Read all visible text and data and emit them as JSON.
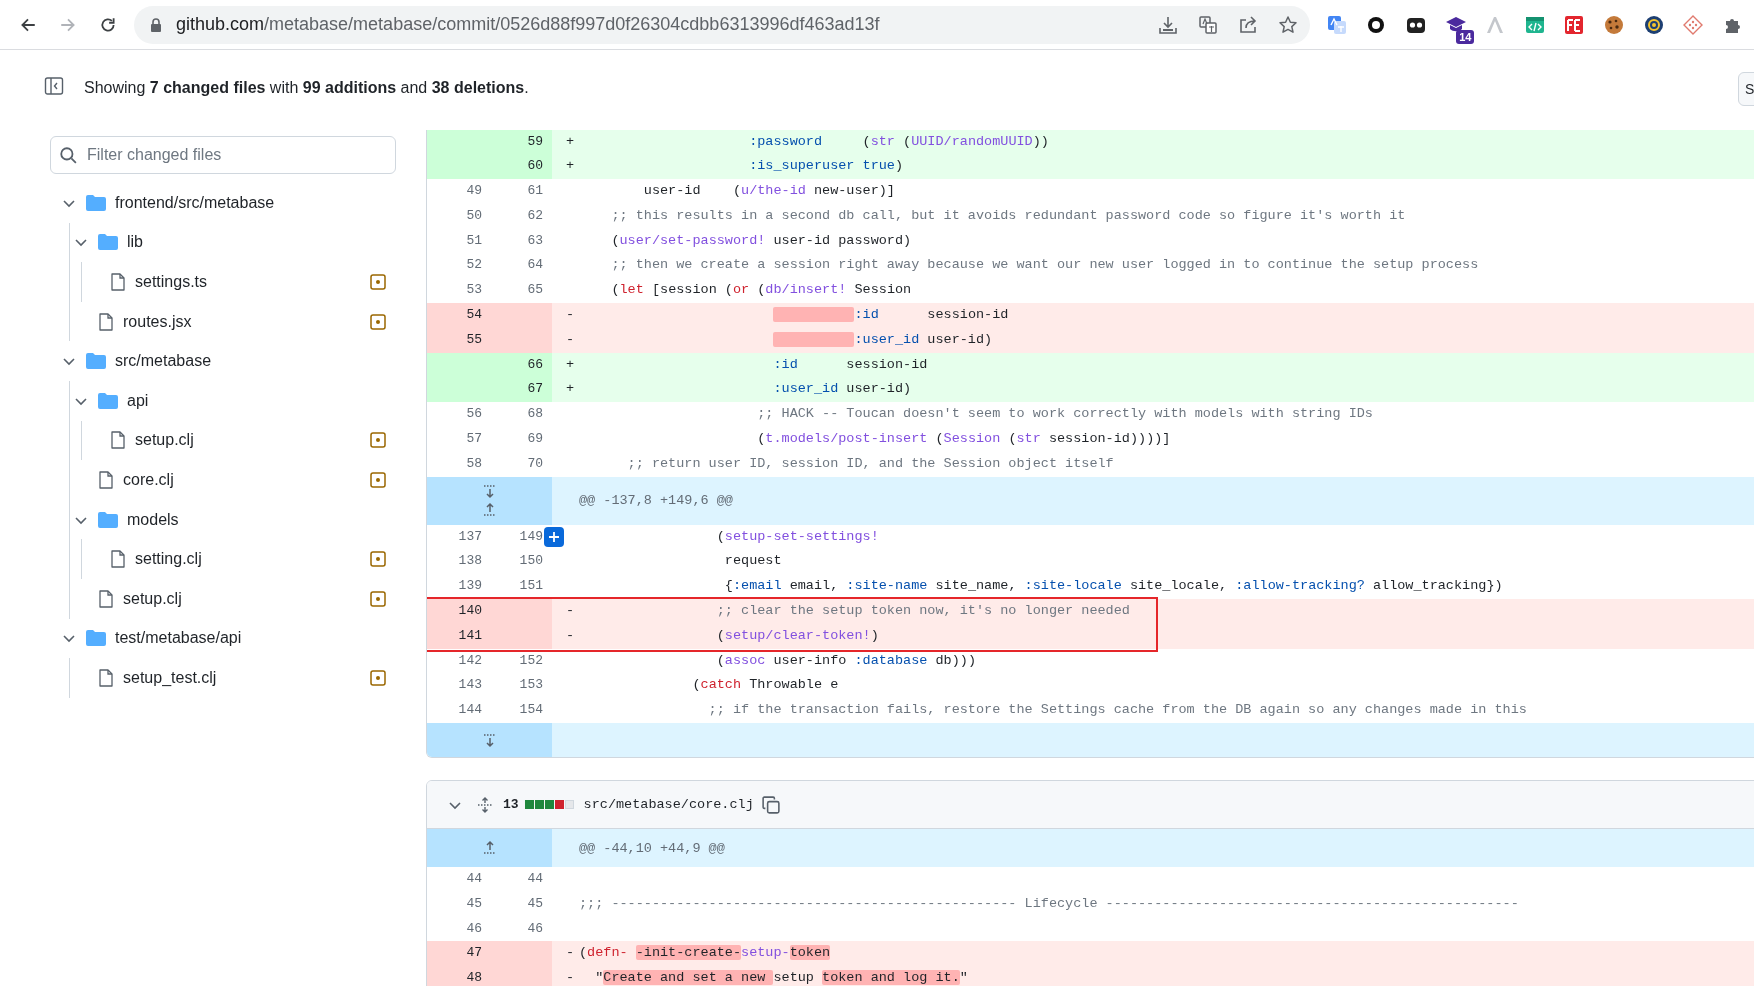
{
  "browser": {
    "nav": [
      {
        "kind": "back",
        "disabled": false
      },
      {
        "kind": "forward",
        "disabled": true
      },
      {
        "kind": "reload",
        "disabled": false
      }
    ],
    "url_domain": "github.com",
    "url_path": "/metabase/metabase/commit/0526d88f997d0f26304cdbb6313996df463ad13f",
    "extension_badge": "14"
  },
  "summary": {
    "text": "Showing **7 changed files** with **99 additions** and **38 deletions**.",
    "side_button": "S"
  },
  "filter": {
    "placeholder": "Filter changed files"
  },
  "tree": [
    {
      "kind": "folder",
      "name": "frontend/src/metabase",
      "expanded": true,
      "children": [
        {
          "kind": "folder",
          "name": "lib",
          "expanded": true,
          "children": [
            {
              "kind": "file",
              "name": "settings.ts",
              "modified": true
            }
          ]
        },
        {
          "kind": "file",
          "name": "routes.jsx",
          "modified": true
        }
      ]
    },
    {
      "kind": "folder",
      "name": "src/metabase",
      "expanded": true,
      "children": [
        {
          "kind": "folder",
          "name": "api",
          "expanded": true,
          "children": [
            {
              "kind": "file",
              "name": "setup.clj",
              "modified": true
            }
          ]
        },
        {
          "kind": "file",
          "name": "core.clj",
          "modified": true
        },
        {
          "kind": "folder",
          "name": "models",
          "expanded": true,
          "children": [
            {
              "kind": "file",
              "name": "setting.clj",
              "modified": true
            }
          ]
        },
        {
          "kind": "file",
          "name": "setup.clj",
          "modified": true
        }
      ]
    },
    {
      "kind": "folder",
      "name": "test/metabase/api",
      "expanded": true,
      "children": [
        {
          "kind": "file",
          "name": "setup_test.clj",
          "modified": true
        }
      ]
    }
  ],
  "diffs": [
    {
      "rows": [
        {
          "kind": "add",
          "new": "59",
          "marker": "+",
          "code": [
            {
              "kind": "symbol",
              "text": "                     :password"
            },
            {
              "kind": "plain",
              "text": "     ("
            },
            {
              "kind": "function",
              "text": "str"
            },
            {
              "kind": "plain",
              "text": " ("
            },
            {
              "kind": "function",
              "text": "UUID/randomUUID"
            },
            {
              "kind": "plain",
              "text": "))"
            }
          ]
        },
        {
          "kind": "add",
          "new": "60",
          "marker": "+",
          "code": [
            {
              "kind": "symbol",
              "text": "                     :is_superuser"
            },
            {
              "kind": "symbol",
              "text": " true"
            },
            {
              "kind": "plain",
              "text": ")"
            }
          ]
        },
        {
          "kind": "context",
          "old": "49",
          "new": "61",
          "code": [
            {
              "kind": "plain",
              "text": "        user-id    ("
            },
            {
              "kind": "function",
              "text": "u/the-id"
            },
            {
              "kind": "plain",
              "text": " new-user)]"
            }
          ]
        },
        {
          "kind": "context",
          "old": "50",
          "new": "62",
          "code": [
            {
              "kind": "comment",
              "text": "    ;; this results in a second db call, but it avoids redundant password code so figure it's worth it"
            }
          ]
        },
        {
          "kind": "context",
          "old": "51",
          "new": "63",
          "code": [
            {
              "kind": "plain",
              "text": "    ("
            },
            {
              "kind": "function",
              "text": "user/set-password!"
            },
            {
              "kind": "plain",
              "text": " user-id password)"
            }
          ]
        },
        {
          "kind": "context",
          "old": "52",
          "new": "64",
          "code": [
            {
              "kind": "comment",
              "text": "    ;; then we create a session right away because we want our new user logged in to continue the setup process"
            }
          ]
        },
        {
          "kind": "context",
          "old": "53",
          "new": "65",
          "code": [
            {
              "kind": "plain",
              "text": "    ("
            },
            {
              "kind": "keyword",
              "text": "let"
            },
            {
              "kind": "plain",
              "text": " [session ("
            },
            {
              "kind": "keyword",
              "text": "or"
            },
            {
              "kind": "plain",
              "text": " ("
            },
            {
              "kind": "function",
              "text": "db/insert!"
            },
            {
              "kind": "plain",
              "text": " Session"
            }
          ]
        },
        {
          "kind": "delete",
          "old": "54",
          "marker": "-",
          "indent_removed": true,
          "code": [
            {
              "kind": "symbol",
              "text": "                                  :id"
            },
            {
              "kind": "plain",
              "text": "      session-id"
            }
          ]
        },
        {
          "kind": "delete",
          "old": "55",
          "marker": "-",
          "indent_removed": true,
          "code": [
            {
              "kind": "symbol",
              "text": "                                  :user_id"
            },
            {
              "kind": "plain",
              "text": " user-id)"
            }
          ]
        },
        {
          "kind": "add",
          "new": "66",
          "marker": "+",
          "code": [
            {
              "kind": "symbol",
              "text": "                        :id"
            },
            {
              "kind": "plain",
              "text": "      session-id"
            }
          ]
        },
        {
          "kind": "add",
          "new": "67",
          "marker": "+",
          "code": [
            {
              "kind": "symbol",
              "text": "                        :user_id"
            },
            {
              "kind": "plain",
              "text": " user-id)"
            }
          ]
        },
        {
          "kind": "context",
          "old": "56",
          "new": "68",
          "code": [
            {
              "kind": "comment",
              "text": "                      ;; HACK -- Toucan doesn't seem to work correctly with models with string IDs"
            }
          ]
        },
        {
          "kind": "context",
          "old": "57",
          "new": "69",
          "code": [
            {
              "kind": "plain",
              "text": "                      ("
            },
            {
              "kind": "function",
              "text": "t.models/post-insert"
            },
            {
              "kind": "plain",
              "text": " ("
            },
            {
              "kind": "function",
              "text": "Session"
            },
            {
              "kind": "plain",
              "text": " ("
            },
            {
              "kind": "function",
              "text": "str"
            },
            {
              "kind": "plain",
              "text": " session-id))))]"
            }
          ]
        },
        {
          "kind": "context",
          "old": "58",
          "new": "70",
          "code": [
            {
              "kind": "comment",
              "text": "      ;; return user ID, session ID, and the Session object itself"
            }
          ]
        },
        {
          "kind": "hunk",
          "expand": [
            {
              "kind": "down"
            },
            {
              "kind": "up"
            }
          ],
          "header": "@@ -137,8 +149,6 @@"
        },
        {
          "kind": "context",
          "old": "137",
          "new": "149",
          "comment_button": true,
          "code": [
            {
              "kind": "plain",
              "text": "                 ("
            },
            {
              "kind": "function",
              "text": "setup-set-settings!"
            }
          ]
        },
        {
          "kind": "context",
          "old": "138",
          "new": "150",
          "code": [
            {
              "kind": "plain",
              "text": "                  request"
            }
          ]
        },
        {
          "kind": "context",
          "old": "139",
          "new": "151",
          "code": [
            {
              "kind": "plain",
              "text": "                  {"
            },
            {
              "kind": "symbol",
              "text": ":email"
            },
            {
              "kind": "plain",
              "text": " email, "
            },
            {
              "kind": "symbol",
              "text": ":site-name"
            },
            {
              "kind": "plain",
              "text": " site_name, "
            },
            {
              "kind": "symbol",
              "text": ":site-locale"
            },
            {
              "kind": "plain",
              "text": " site_locale, "
            },
            {
              "kind": "symbol",
              "text": ":allow-tracking?"
            },
            {
              "kind": "plain",
              "text": " allow_tracking})"
            }
          ]
        },
        {
          "kind": "delete",
          "old": "140",
          "marker": "-",
          "boxed": true,
          "code": [
            {
              "kind": "comment",
              "text": "                 ;; clear the setup token now, it's no longer needed"
            }
          ]
        },
        {
          "kind": "delete",
          "old": "141",
          "marker": "-",
          "boxed": true,
          "code": [
            {
              "kind": "plain",
              "text": "                 ("
            },
            {
              "kind": "function",
              "text": "setup/clear-token!"
            },
            {
              "kind": "plain",
              "text": ")"
            }
          ]
        },
        {
          "kind": "context",
          "old": "142",
          "new": "152",
          "code": [
            {
              "kind": "plain",
              "text": "                 ("
            },
            {
              "kind": "function",
              "text": "assoc"
            },
            {
              "kind": "plain",
              "text": " user-info "
            },
            {
              "kind": "symbol",
              "text": ":database"
            },
            {
              "kind": "plain",
              "text": " db)))"
            }
          ]
        },
        {
          "kind": "context",
          "old": "143",
          "new": "153",
          "code": [
            {
              "kind": "plain",
              "text": "              ("
            },
            {
              "kind": "keyword",
              "text": "catch"
            },
            {
              "kind": "plain",
              "text": " Throwable e"
            }
          ]
        },
        {
          "kind": "context",
          "old": "144",
          "new": "154",
          "code": [
            {
              "kind": "comment",
              "text": "                ;; if the transaction fails, restore the Settings cache from the DB again so any changes made in this"
            }
          ]
        },
        {
          "kind": "expand",
          "expand": [
            {
              "kind": "down"
            }
          ]
        }
      ]
    },
    {
      "header": {
        "expanded": true,
        "changes": "13",
        "diffstat": [
          {
            "kind": "add"
          },
          {
            "kind": "add"
          },
          {
            "kind": "add"
          },
          {
            "kind": "delete"
          },
          {
            "kind": "neutral"
          }
        ],
        "path": "src/metabase/core.clj"
      },
      "rows": [
        {
          "kind": "hunk",
          "expand": [
            {
              "kind": "up"
            }
          ],
          "header": "@@ -44,10 +44,9 @@"
        },
        {
          "kind": "context",
          "old": "44",
          "new": "44",
          "code": []
        },
        {
          "kind": "context",
          "old": "45",
          "new": "45",
          "code": [
            {
              "kind": "comment",
              "text": ";;; -------------------------------------------------- Lifecycle ---------------------------------------------------"
            }
          ]
        },
        {
          "kind": "context",
          "old": "46",
          "new": "46",
          "code": []
        },
        {
          "kind": "delete",
          "old": "47",
          "marker": "-",
          "code": [
            {
              "kind": "plain",
              "text": "("
            },
            {
              "kind": "keyword",
              "text": "defn- "
            },
            {
              "kind": "removed",
              "text": "-init-create-"
            },
            {
              "kind": "function",
              "text": "setup-"
            },
            {
              "kind": "removed",
              "text": "token"
            }
          ]
        },
        {
          "kind": "delete",
          "old": "48",
          "marker": "-",
          "code": [
            {
              "kind": "plain",
              "text": "  \""
            },
            {
              "kind": "removed",
              "text": "Create and set a new "
            },
            {
              "kind": "plain",
              "text": "setup "
            },
            {
              "kind": "removed",
              "text": "token and log it."
            },
            {
              "kind": "plain",
              "text": "\""
            }
          ]
        }
      ]
    }
  ]
}
